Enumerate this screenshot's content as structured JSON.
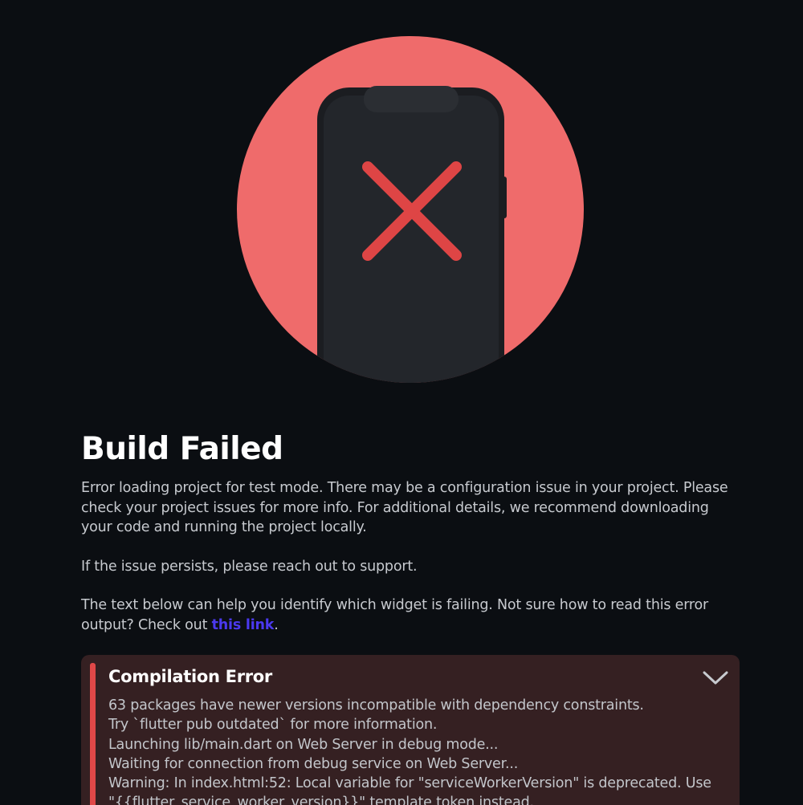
{
  "illustration": {
    "icon": "phone-error-icon",
    "circle_color": "#ef6b6b",
    "phone_color": "#22252a",
    "x_color": "#de4545"
  },
  "heading": {
    "title": "Build Failed"
  },
  "body": {
    "paragraph1": "Error loading project for test mode. There may be a configuration issue in your project. Please check your project issues for more info. For additional details, we recommend downloading your code and running the project locally.",
    "paragraph2": "If the issue persists, please reach out to support.",
    "paragraph3_prefix": "The text below can help you identify which widget is failing. Not sure how to read this error output? Check out ",
    "link_label": "this link",
    "paragraph3_suffix": ".",
    "link_color": "#4b39ef"
  },
  "error_panel": {
    "title": "Compilation Error",
    "toggle_icon": "chevron-down-icon",
    "accent_color": "#e04848",
    "background_color": "#352022",
    "lines": [
      "63 packages have newer versions incompatible with dependency constraints.",
      "Try `flutter pub outdated` for more information.",
      "Launching lib/main.dart on Web Server in debug mode...",
      "Waiting for connection from debug service on Web Server...",
      "Warning: In index.html:52: Local variable for \"serviceWorkerVersion\" is deprecated. Use",
      "\"{{flutter_service_worker_version}}\" template token instead."
    ]
  }
}
